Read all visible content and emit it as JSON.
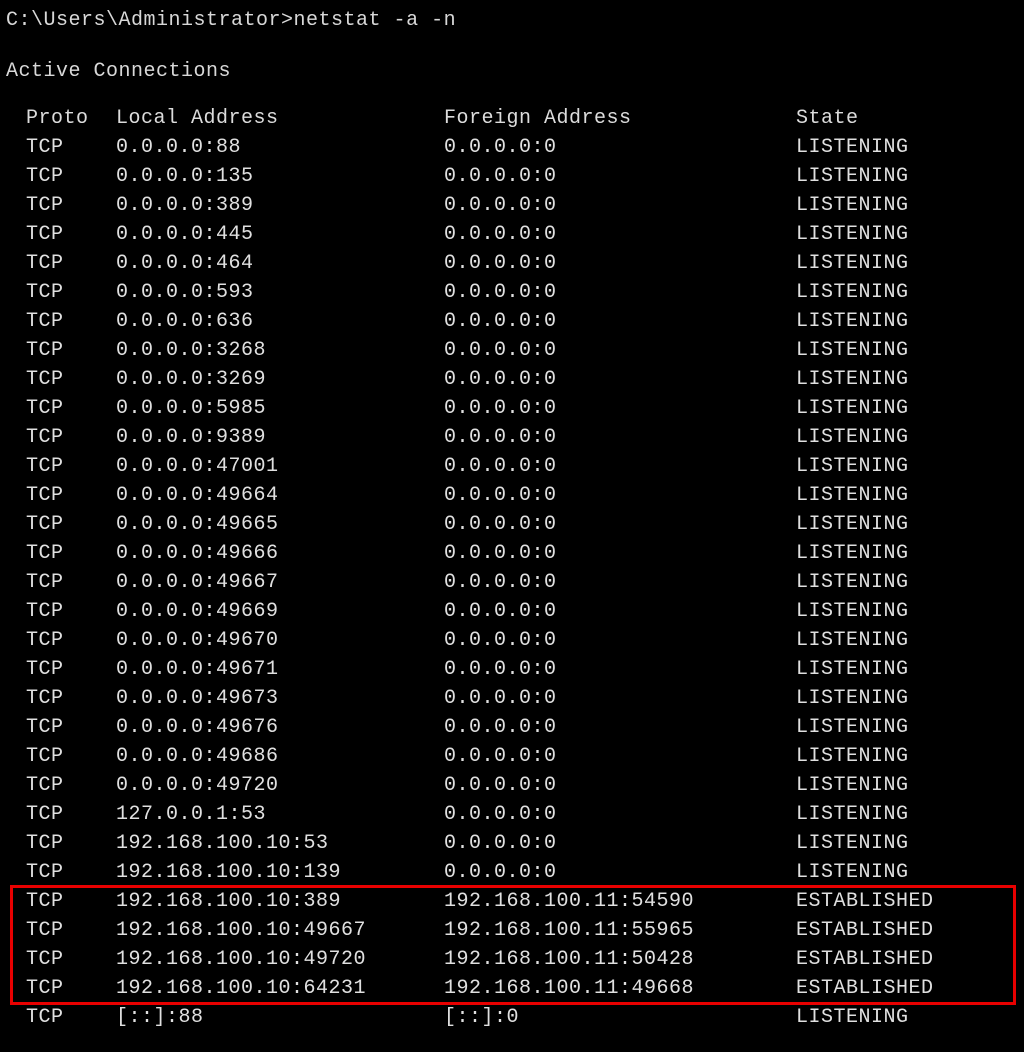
{
  "prompt": "C:\\Users\\Administrator>netstat -a -n",
  "section_title": "Active Connections",
  "headers": {
    "proto": "Proto",
    "local": "Local Address",
    "foreign": "Foreign Address",
    "state": "State"
  },
  "highlight": {
    "start": 26,
    "end": 29
  },
  "rows": [
    {
      "proto": "TCP",
      "local": "0.0.0.0:88",
      "foreign": "0.0.0.0:0",
      "state": "LISTENING"
    },
    {
      "proto": "TCP",
      "local": "0.0.0.0:135",
      "foreign": "0.0.0.0:0",
      "state": "LISTENING"
    },
    {
      "proto": "TCP",
      "local": "0.0.0.0:389",
      "foreign": "0.0.0.0:0",
      "state": "LISTENING"
    },
    {
      "proto": "TCP",
      "local": "0.0.0.0:445",
      "foreign": "0.0.0.0:0",
      "state": "LISTENING"
    },
    {
      "proto": "TCP",
      "local": "0.0.0.0:464",
      "foreign": "0.0.0.0:0",
      "state": "LISTENING"
    },
    {
      "proto": "TCP",
      "local": "0.0.0.0:593",
      "foreign": "0.0.0.0:0",
      "state": "LISTENING"
    },
    {
      "proto": "TCP",
      "local": "0.0.0.0:636",
      "foreign": "0.0.0.0:0",
      "state": "LISTENING"
    },
    {
      "proto": "TCP",
      "local": "0.0.0.0:3268",
      "foreign": "0.0.0.0:0",
      "state": "LISTENING"
    },
    {
      "proto": "TCP",
      "local": "0.0.0.0:3269",
      "foreign": "0.0.0.0:0",
      "state": "LISTENING"
    },
    {
      "proto": "TCP",
      "local": "0.0.0.0:5985",
      "foreign": "0.0.0.0:0",
      "state": "LISTENING"
    },
    {
      "proto": "TCP",
      "local": "0.0.0.0:9389",
      "foreign": "0.0.0.0:0",
      "state": "LISTENING"
    },
    {
      "proto": "TCP",
      "local": "0.0.0.0:47001",
      "foreign": "0.0.0.0:0",
      "state": "LISTENING"
    },
    {
      "proto": "TCP",
      "local": "0.0.0.0:49664",
      "foreign": "0.0.0.0:0",
      "state": "LISTENING"
    },
    {
      "proto": "TCP",
      "local": "0.0.0.0:49665",
      "foreign": "0.0.0.0:0",
      "state": "LISTENING"
    },
    {
      "proto": "TCP",
      "local": "0.0.0.0:49666",
      "foreign": "0.0.0.0:0",
      "state": "LISTENING"
    },
    {
      "proto": "TCP",
      "local": "0.0.0.0:49667",
      "foreign": "0.0.0.0:0",
      "state": "LISTENING"
    },
    {
      "proto": "TCP",
      "local": "0.0.0.0:49669",
      "foreign": "0.0.0.0:0",
      "state": "LISTENING"
    },
    {
      "proto": "TCP",
      "local": "0.0.0.0:49670",
      "foreign": "0.0.0.0:0",
      "state": "LISTENING"
    },
    {
      "proto": "TCP",
      "local": "0.0.0.0:49671",
      "foreign": "0.0.0.0:0",
      "state": "LISTENING"
    },
    {
      "proto": "TCP",
      "local": "0.0.0.0:49673",
      "foreign": "0.0.0.0:0",
      "state": "LISTENING"
    },
    {
      "proto": "TCP",
      "local": "0.0.0.0:49676",
      "foreign": "0.0.0.0:0",
      "state": "LISTENING"
    },
    {
      "proto": "TCP",
      "local": "0.0.0.0:49686",
      "foreign": "0.0.0.0:0",
      "state": "LISTENING"
    },
    {
      "proto": "TCP",
      "local": "0.0.0.0:49720",
      "foreign": "0.0.0.0:0",
      "state": "LISTENING"
    },
    {
      "proto": "TCP",
      "local": "127.0.0.1:53",
      "foreign": "0.0.0.0:0",
      "state": "LISTENING"
    },
    {
      "proto": "TCP",
      "local": "192.168.100.10:53",
      "foreign": "0.0.0.0:0",
      "state": "LISTENING"
    },
    {
      "proto": "TCP",
      "local": "192.168.100.10:139",
      "foreign": "0.0.0.0:0",
      "state": "LISTENING"
    },
    {
      "proto": "TCP",
      "local": "192.168.100.10:389",
      "foreign": "192.168.100.11:54590",
      "state": "ESTABLISHED"
    },
    {
      "proto": "TCP",
      "local": "192.168.100.10:49667",
      "foreign": "192.168.100.11:55965",
      "state": "ESTABLISHED"
    },
    {
      "proto": "TCP",
      "local": "192.168.100.10:49720",
      "foreign": "192.168.100.11:50428",
      "state": "ESTABLISHED"
    },
    {
      "proto": "TCP",
      "local": "192.168.100.10:64231",
      "foreign": "192.168.100.11:49668",
      "state": "ESTABLISHED"
    },
    {
      "proto": "TCP",
      "local": "[::]:88",
      "foreign": "[::]:0",
      "state": "LISTENING"
    }
  ]
}
